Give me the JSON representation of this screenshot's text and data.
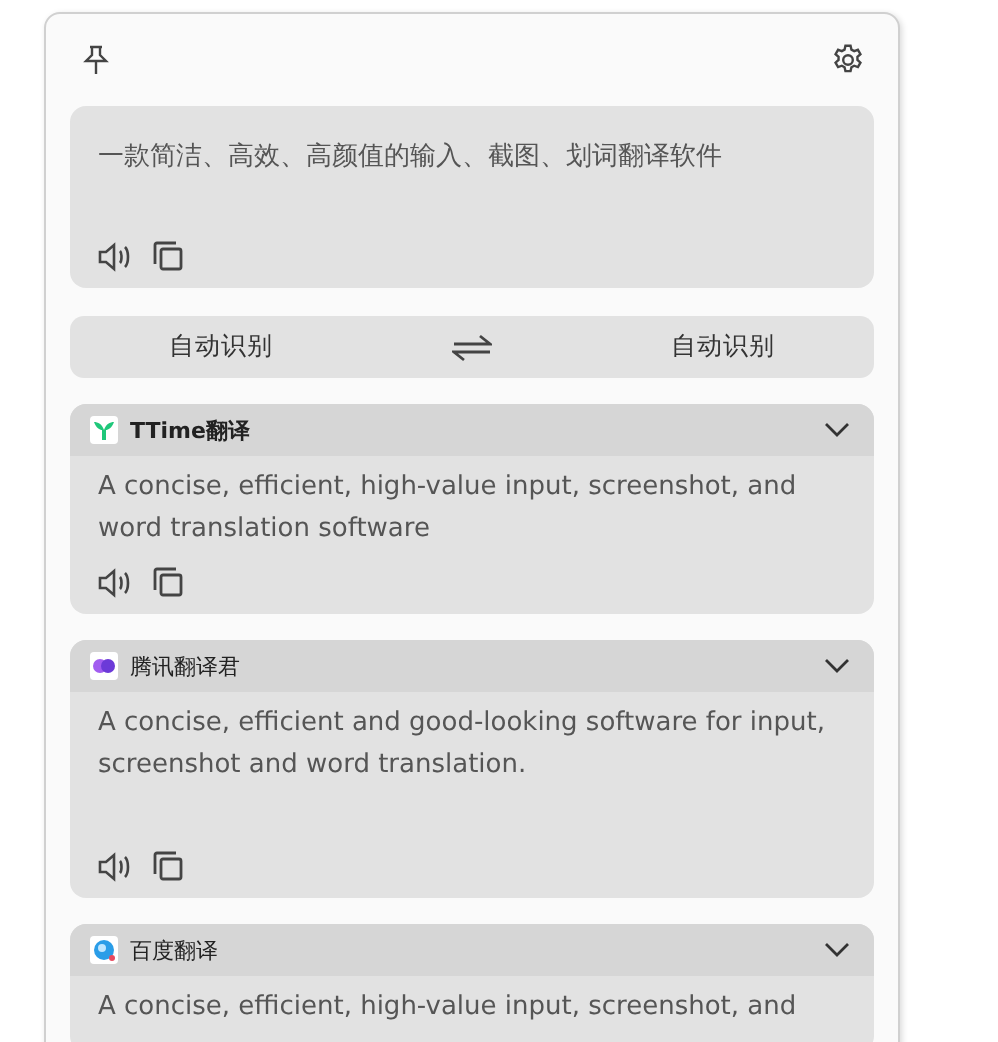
{
  "source": {
    "text": "一款简洁、高效、高颜值的输入、截图、划词翻译软件"
  },
  "languages": {
    "from": "自动识别",
    "to": "自动识别"
  },
  "results": [
    {
      "service": "TTime翻译",
      "kind": "leaf",
      "bold": true,
      "text": "A concise, efficient, high-value input, screenshot, and word translation software",
      "actions": true
    },
    {
      "service": "腾讯翻译君",
      "kind": "bubble",
      "bold": false,
      "text": "A concise, efficient and good-looking software for input, screenshot and word translation.",
      "actions": true
    },
    {
      "service": "百度翻译",
      "kind": "globe",
      "bold": false,
      "text": "A concise, efficient, high-value input, screenshot, and",
      "actions": false
    }
  ]
}
